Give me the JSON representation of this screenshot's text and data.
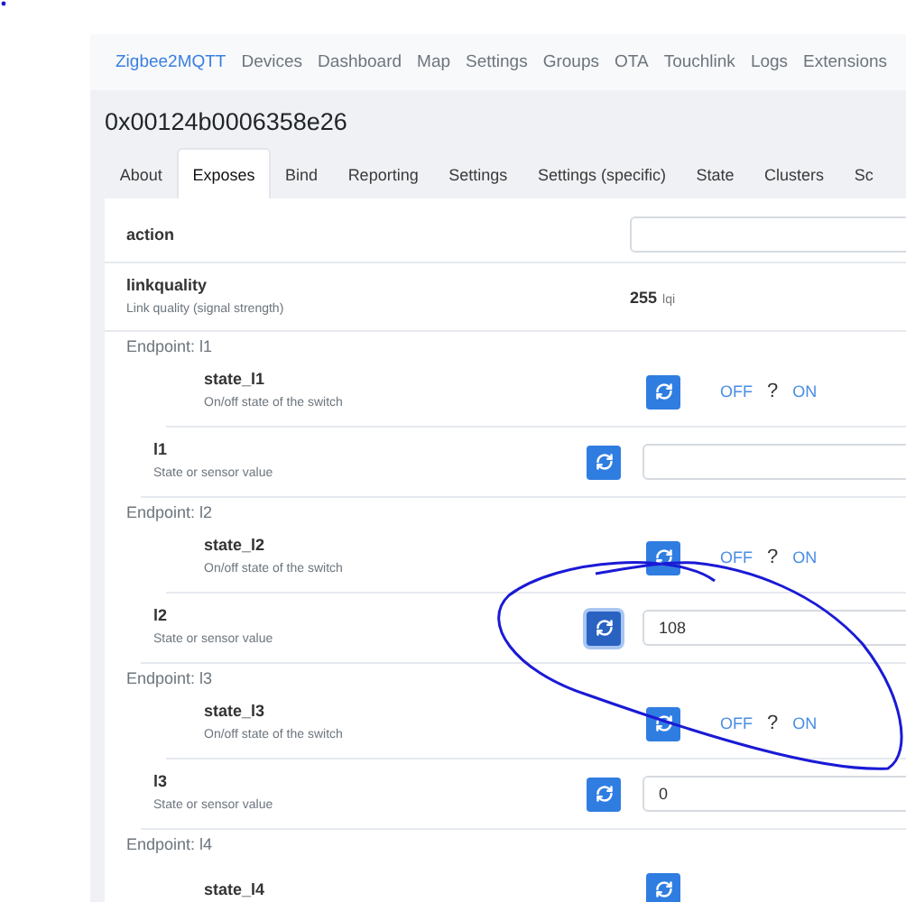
{
  "navbar": {
    "brand": "Zigbee2MQTT",
    "links": [
      "Devices",
      "Dashboard",
      "Map",
      "Settings",
      "Groups",
      "OTA",
      "Touchlink",
      "Logs",
      "Extensions"
    ]
  },
  "device_title": "0x00124b0006358e26",
  "tabs": [
    {
      "label": "About",
      "selected": false
    },
    {
      "label": "Exposes",
      "selected": true
    },
    {
      "label": "Bind",
      "selected": false
    },
    {
      "label": "Reporting",
      "selected": false
    },
    {
      "label": "Settings",
      "selected": false
    },
    {
      "label": "Settings (specific)",
      "selected": false
    },
    {
      "label": "State",
      "selected": false
    },
    {
      "label": "Clusters",
      "selected": false
    },
    {
      "label": "Sc",
      "selected": false
    }
  ],
  "exposes": [
    {
      "kind": "field",
      "name": "action"
    },
    {
      "kind": "reading",
      "name": "linkquality",
      "description": "Link quality (signal strength)",
      "value": "255",
      "unit": "lqi"
    }
  ],
  "endpoints": [
    {
      "label": "Endpoint: l1",
      "children": [
        {
          "kind": "switch",
          "name": "state_l1",
          "description": "On/off state of the switch",
          "off": "OFF",
          "unknown": "?",
          "on": "ON",
          "focused": false
        },
        {
          "kind": "field",
          "name": "l1",
          "description": "State or sensor value",
          "focused": false
        }
      ]
    },
    {
      "label": "Endpoint: l2",
      "children": [
        {
          "kind": "switch",
          "name": "state_l2",
          "description": "On/off state of the switch",
          "off": "OFF",
          "unknown": "?",
          "on": "ON",
          "focused": false
        },
        {
          "kind": "field",
          "name": "l2",
          "description": "State or sensor value",
          "value": "108",
          "focused": true
        }
      ]
    },
    {
      "label": "Endpoint: l3",
      "children": [
        {
          "kind": "switch",
          "name": "state_l3",
          "description": "On/off state of the switch",
          "off": "OFF",
          "unknown": "?",
          "on": "ON",
          "focused": false
        },
        {
          "kind": "field",
          "name": "l3",
          "description": "State or sensor value",
          "value": "0",
          "focused": false
        }
      ]
    },
    {
      "label": "Endpoint: l4",
      "children": [
        {
          "kind": "switch",
          "name": "state_l4",
          "focused": false
        }
      ]
    }
  ]
}
